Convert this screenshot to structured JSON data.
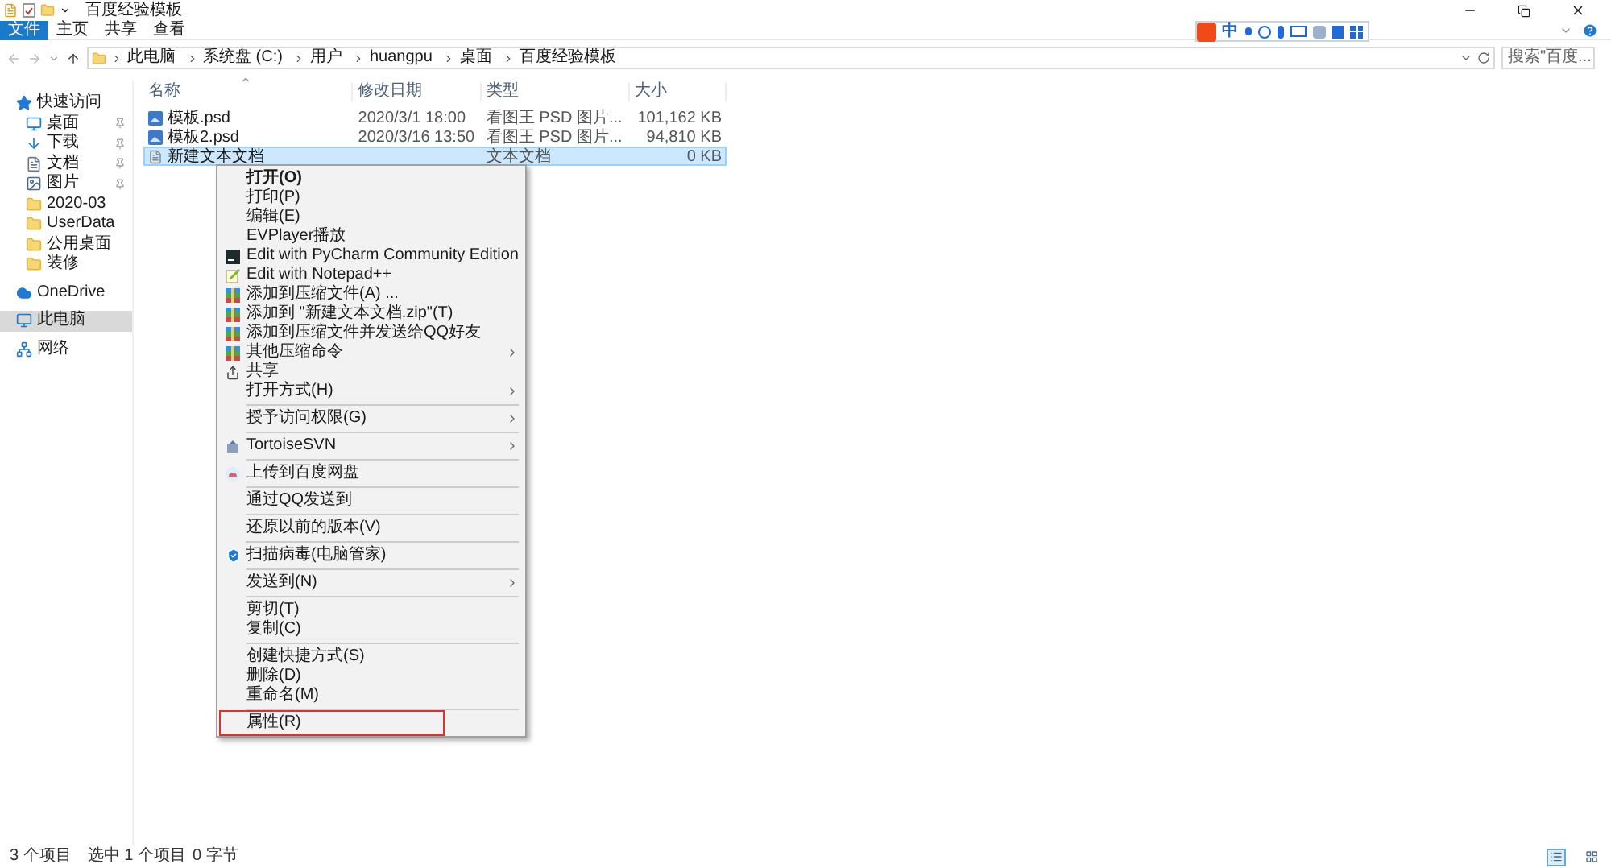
{
  "window": {
    "title": "百度经验模板"
  },
  "ribbon_tabs": [
    {
      "label": "文件",
      "selected": true
    },
    {
      "label": "主页",
      "selected": false
    },
    {
      "label": "共享",
      "selected": false
    },
    {
      "label": "查看",
      "selected": false
    }
  ],
  "ime_toolbar": {
    "mode": "中"
  },
  "address": {
    "path": [
      "此电脑",
      "系统盘 (C:)",
      "用户",
      "huangpu",
      "桌面",
      "百度经验模板"
    ]
  },
  "search": {
    "placeholder": "搜索\"百度..."
  },
  "sidebar": [
    [
      {
        "label": "快速访问",
        "pinned": false,
        "selected": false
      },
      {
        "label": "桌面",
        "pinned": true,
        "selected": false
      },
      {
        "label": "下载",
        "pinned": true,
        "selected": false
      },
      {
        "label": "文档",
        "pinned": true,
        "selected": false
      },
      {
        "label": "图片",
        "pinned": true,
        "selected": false
      },
      {
        "label": "2020-03",
        "pinned": false,
        "selected": false
      },
      {
        "label": "UserData",
        "pinned": false,
        "selected": false
      },
      {
        "label": "公用桌面",
        "pinned": false,
        "selected": false
      },
      {
        "label": "装修",
        "pinned": false,
        "selected": false
      }
    ],
    [
      {
        "label": "OneDrive",
        "pinned": false,
        "selected": false
      }
    ],
    [
      {
        "label": "此电脑",
        "pinned": false,
        "selected": true
      }
    ],
    [
      {
        "label": "网络",
        "pinned": false,
        "selected": false
      }
    ]
  ],
  "files": {
    "columns": [
      "名称",
      "修改日期",
      "类型",
      "大小"
    ],
    "rows": [
      {
        "name": "模板.psd",
        "date": "2020/3/1 18:00",
        "type": "看图王 PSD 图片...",
        "size": "101,162 KB",
        "selected": false
      },
      {
        "name": "模板2.psd",
        "date": "2020/3/16 13:50",
        "type": "看图王 PSD 图片...",
        "size": "94,810 KB",
        "selected": false
      },
      {
        "name": "新建文本文档",
        "type": "文本文档",
        "size": "0 KB",
        "selected": true
      }
    ]
  },
  "context_menu": [
    {
      "kind": "item",
      "label": "打开(O)",
      "bold": true,
      "submenu": false,
      "highlighted": false
    },
    {
      "kind": "item",
      "label": "打印(P)",
      "bold": false,
      "submenu": false,
      "highlighted": false
    },
    {
      "kind": "item",
      "label": "编辑(E)",
      "bold": false,
      "submenu": false,
      "highlighted": false
    },
    {
      "kind": "item",
      "label": "EVPlayer播放",
      "bold": false,
      "submenu": false,
      "highlighted": false
    },
    {
      "kind": "item",
      "label": "Edit with PyCharm Community Edition",
      "bold": false,
      "submenu": false,
      "highlighted": false
    },
    {
      "kind": "item",
      "label": "Edit with Notepad++",
      "bold": false,
      "submenu": false,
      "highlighted": false
    },
    {
      "kind": "item",
      "label": "添加到压缩文件(A) ...",
      "bold": false,
      "submenu": false,
      "highlighted": false
    },
    {
      "kind": "item",
      "label": "添加到 \"新建文本文档.zip\"(T)",
      "bold": false,
      "submenu": false,
      "highlighted": false
    },
    {
      "kind": "item",
      "label": "添加到压缩文件并发送给QQ好友",
      "bold": false,
      "submenu": false,
      "highlighted": false
    },
    {
      "kind": "item",
      "label": "其他压缩命令",
      "bold": false,
      "submenu": true,
      "highlighted": false
    },
    {
      "kind": "item",
      "label": "共享",
      "bold": false,
      "submenu": false,
      "highlighted": false
    },
    {
      "kind": "item",
      "label": "打开方式(H)",
      "bold": false,
      "submenu": true,
      "highlighted": false
    },
    {
      "kind": "separator"
    },
    {
      "kind": "item",
      "label": "授予访问权限(G)",
      "bold": false,
      "submenu": true,
      "highlighted": false
    },
    {
      "kind": "separator"
    },
    {
      "kind": "item",
      "label": "TortoiseSVN",
      "bold": false,
      "submenu": true,
      "highlighted": false
    },
    {
      "kind": "separator"
    },
    {
      "kind": "item",
      "label": "上传到百度网盘",
      "bold": false,
      "submenu": false,
      "highlighted": false
    },
    {
      "kind": "separator"
    },
    {
      "kind": "item",
      "label": "通过QQ发送到",
      "bold": false,
      "submenu": false,
      "highlighted": false
    },
    {
      "kind": "separator"
    },
    {
      "kind": "item",
      "label": "还原以前的版本(V)",
      "bold": false,
      "submenu": false,
      "highlighted": false
    },
    {
      "kind": "separator"
    },
    {
      "kind": "item",
      "label": "扫描病毒(电脑管家)",
      "bold": false,
      "submenu": false,
      "highlighted": false
    },
    {
      "kind": "separator"
    },
    {
      "kind": "item",
      "label": "发送到(N)",
      "bold": false,
      "submenu": true,
      "highlighted": false
    },
    {
      "kind": "separator"
    },
    {
      "kind": "item",
      "label": "剪切(T)",
      "bold": false,
      "submenu": false,
      "highlighted": false
    },
    {
      "kind": "item",
      "label": "复制(C)",
      "bold": false,
      "submenu": false,
      "highlighted": false
    },
    {
      "kind": "separator"
    },
    {
      "kind": "item",
      "label": "创建快捷方式(S)",
      "bold": false,
      "submenu": false,
      "highlighted": false
    },
    {
      "kind": "item",
      "label": "删除(D)",
      "bold": false,
      "submenu": false,
      "highlighted": false
    },
    {
      "kind": "item",
      "label": "重命名(M)",
      "bold": false,
      "submenu": false,
      "highlighted": false
    },
    {
      "kind": "separator"
    },
    {
      "kind": "item",
      "label": "属性(R)",
      "bold": false,
      "submenu": false,
      "highlighted": true
    }
  ],
  "status_bar": {
    "count": "3 个项目",
    "selection": "选中 1 个项目",
    "size": "0 字节",
    "views": [
      {
        "kind": "details",
        "selected": true
      },
      {
        "kind": "tiles",
        "selected": false
      }
    ]
  }
}
